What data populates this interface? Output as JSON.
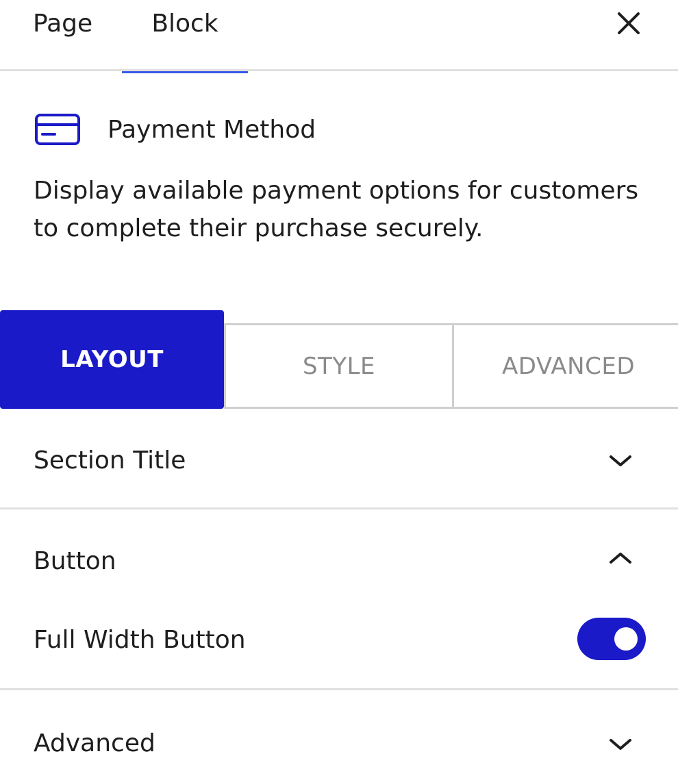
{
  "top_tabs": {
    "page_label": "Page",
    "block_label": "Block",
    "active": "Block"
  },
  "close_icon": "close-icon",
  "block": {
    "icon": "credit-card-icon",
    "title": "Payment Method",
    "description": "Display available payment options for customers to complete their purchase securely."
  },
  "inspector_tabs": [
    {
      "label": "LAYOUT",
      "active": true
    },
    {
      "label": "STYLE",
      "active": false
    },
    {
      "label": "ADVANCED",
      "active": false
    }
  ],
  "panels": [
    {
      "title": "Section Title",
      "expanded": false
    },
    {
      "title": "Button",
      "expanded": true,
      "controls": [
        {
          "label": "Full Width Button",
          "type": "toggle",
          "checked": true
        }
      ]
    },
    {
      "title": "Advanced",
      "expanded": false
    }
  ],
  "colors": {
    "accent": "#1a1ac9",
    "tab_underline": "#3858e9",
    "text": "#1e1e1e",
    "muted": "#8a8a8a",
    "divider": "#e0e0e0"
  }
}
